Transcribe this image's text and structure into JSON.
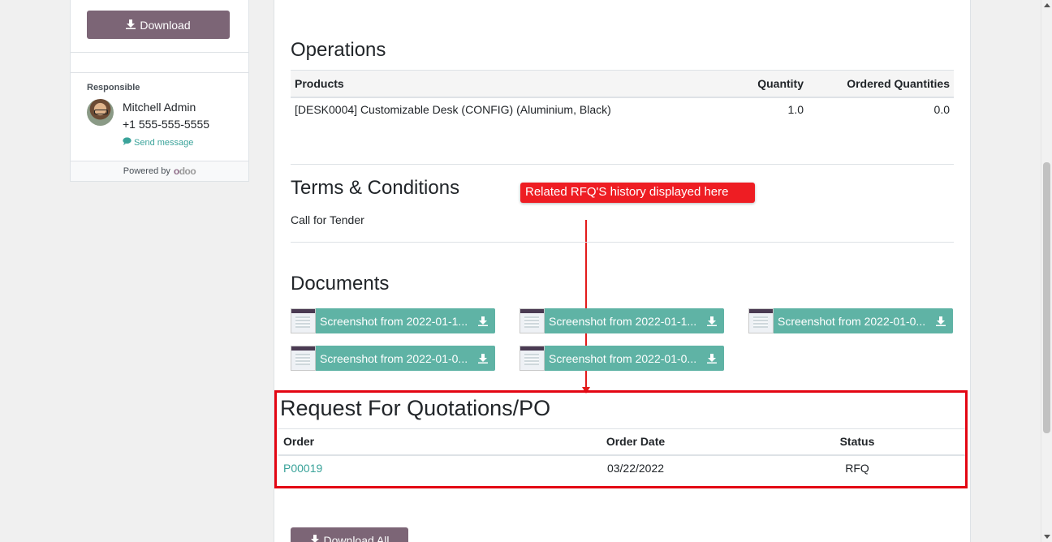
{
  "sidebar": {
    "download_label": "Download",
    "responsible_label": "Responsible",
    "responsible_name": "Mitchell Admin",
    "responsible_phone": "+1 555-555-5555",
    "send_message": "Send message",
    "powered_by": "Powered by",
    "powered_logo": "odoo"
  },
  "operations": {
    "title": "Operations",
    "columns": [
      "Products",
      "Quantity",
      "Ordered Quantities"
    ],
    "rows": [
      {
        "product": "[DESK0004] Customizable Desk (CONFIG) (Aluminium, Black)",
        "quantity": "1.0",
        "ordered": "0.0"
      }
    ]
  },
  "terms": {
    "title": "Terms & Conditions",
    "body": "Call for Tender"
  },
  "annotation": {
    "text": "Related RFQ'S history displayed here",
    "color": "#ee1d23"
  },
  "documents": {
    "title": "Documents",
    "files": [
      "Screenshot from 2022-01-1...",
      "Screenshot from 2022-01-1...",
      "Screenshot from 2022-01-0...",
      "Screenshot from 2022-01-0...",
      "Screenshot from 2022-01-0..."
    ]
  },
  "rfq": {
    "title": "Request For Quotations/PO",
    "columns": [
      "Order",
      "Order Date",
      "Status"
    ],
    "rows": [
      {
        "order": "P00019",
        "date": "03/22/2022",
        "status": "RFQ"
      }
    ]
  },
  "download_all_label": "Download All",
  "colors": {
    "brand": "#7c6576",
    "teal": "#5fb3a5",
    "highlight": "#e30613"
  }
}
